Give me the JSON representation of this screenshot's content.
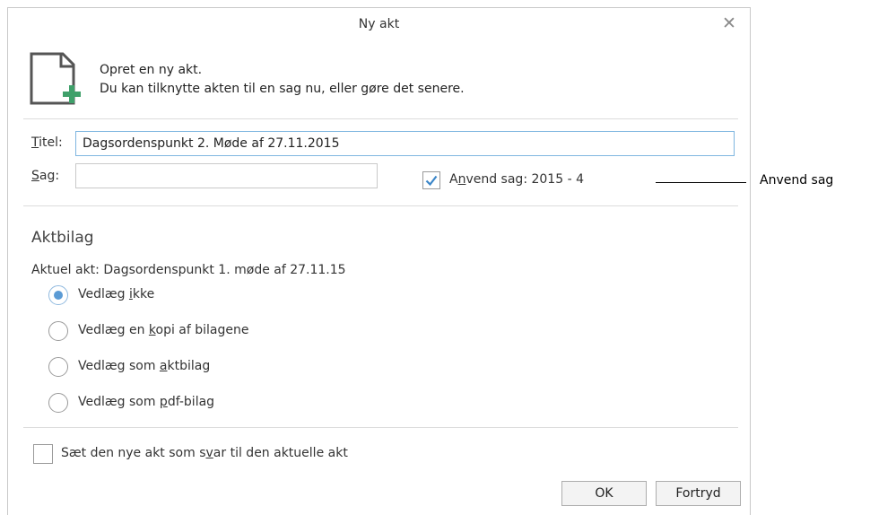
{
  "dialog": {
    "title": "Ny akt",
    "close_symbol": "✕",
    "intro_line1": "Opret en ny akt.",
    "intro_line2": "Du kan tilknytte akten til en sag nu, eller gøre det senere."
  },
  "fields": {
    "titel_label": "Titel:",
    "titel_value": "Dagsordenspunkt 2. Møde af 27.11.2015",
    "sag_label": "Sag:",
    "sag_value": "",
    "anvend_sag_label": "Anvend sag: 2015 - 4",
    "anvend_sag_checked": true
  },
  "aktbilag": {
    "heading": "Aktbilag",
    "aktuel_akt": "Aktuel akt: Dagsordenspunkt 1. møde af 27.11.15",
    "options": [
      {
        "label": "Vedlæg ikke",
        "checked": true
      },
      {
        "label": "Vedlæg en kopi af bilagene",
        "checked": false
      },
      {
        "label": "Vedlæg som aktbilag",
        "checked": false
      },
      {
        "label": "Vedlæg som pdf-bilag",
        "checked": false
      }
    ]
  },
  "reply": {
    "label": "Sæt den nye akt som svar til den aktuelle akt",
    "checked": false
  },
  "buttons": {
    "ok": "OK",
    "cancel": "Fortryd"
  },
  "callout": {
    "label": "Anvend sag"
  },
  "icons": {
    "document": "new-document-icon",
    "plus_color": "#3fa06a",
    "accent": "#5b9bd5"
  }
}
